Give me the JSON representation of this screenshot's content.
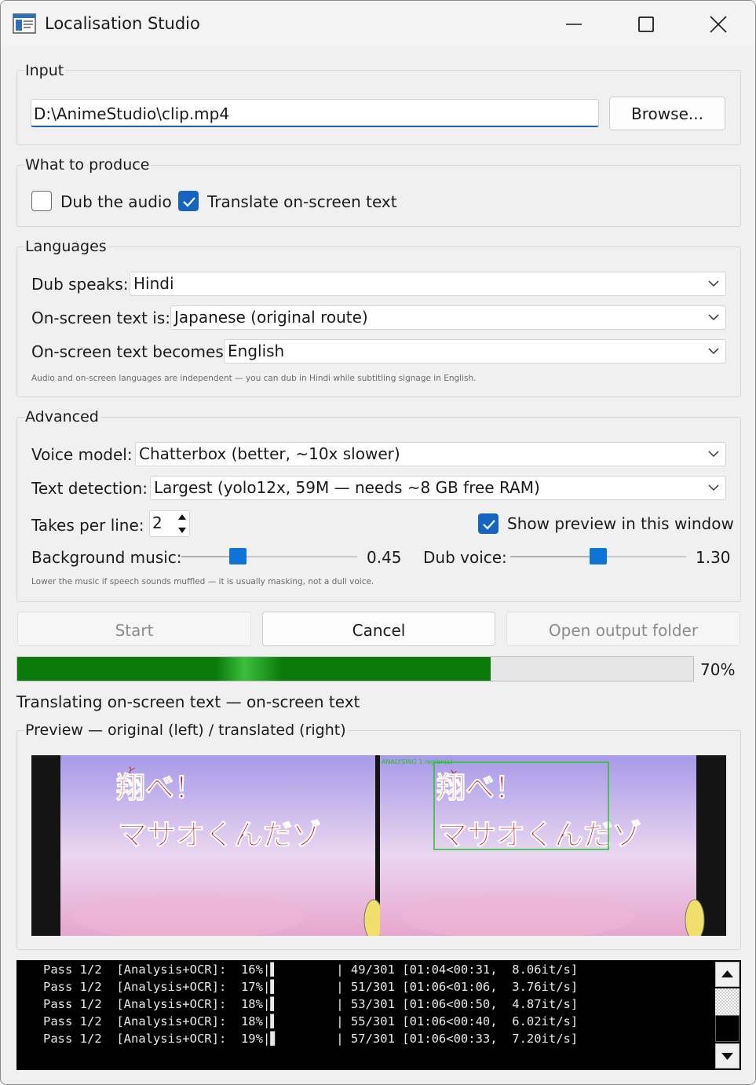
{
  "window": {
    "title": "Localisation Studio"
  },
  "input": {
    "group_title": "Input",
    "path_value": "D:\\AnimeStudio\\clip.mp4",
    "browse_label": "Browse..."
  },
  "produce": {
    "group_title": "What to produce",
    "dub_label": "Dub the audio",
    "dub_checked": false,
    "translate_label": "Translate on-screen text",
    "translate_checked": true
  },
  "languages": {
    "group_title": "Languages",
    "dub_speaks_label": "Dub speaks:",
    "dub_speaks_value": "Hindi",
    "onscreen_is_label": "On-screen text is:",
    "onscreen_is_value": "Japanese (original route)",
    "onscreen_becomes_label": "On-screen text becomes:",
    "onscreen_becomes_value": "English",
    "hint": "Audio and on-screen languages are independent — you can dub in Hindi while subtitling signage in English."
  },
  "advanced": {
    "group_title": "Advanced",
    "voice_model_label": "Voice model:",
    "voice_model_value": "Chatterbox (better, ~10x slower)",
    "text_detection_label": "Text detection:",
    "text_detection_value": "Largest (yolo12x, 59M — needs ~8 GB free RAM)",
    "takes_label": "Takes per line:",
    "takes_value": "2",
    "show_preview_label": "Show preview in this window",
    "show_preview_checked": true,
    "bg_music_label": "Background music:",
    "bg_music_value": "0.45",
    "bg_music_level": 0.45,
    "dub_voice_label": "Dub voice:",
    "dub_voice_value": "1.30",
    "dub_voice_level": 1.3,
    "hint": "Lower the music if speech sounds muffled — it is usually masking, not a dull voice."
  },
  "actions": {
    "start_label": "Start",
    "cancel_label": "Cancel",
    "open_folder_label": "Open output folder"
  },
  "progress": {
    "percent": 70,
    "percent_label": "70%",
    "status": "Translating on-screen text — on-screen text"
  },
  "preview": {
    "group_title": "Preview — original (left) / translated (right)",
    "left_furigana": "と",
    "left_line1": "翔べ！",
    "left_line2": "マサオくんだゾ",
    "right_furigana": "と",
    "right_line1": "翔べ！",
    "right_line2": "マサオくんだゾ",
    "overlay_label": "ANALYSING  1 region(s)"
  },
  "console": {
    "lines": [
      "Pass 1/2  [Analysis+OCR]:  16%|▌        | 49/301 [01:04<00:31,  8.06it/s]",
      "Pass 1/2  [Analysis+OCR]:  17%|▌        | 51/301 [01:06<01:06,  3.76it/s]",
      "Pass 1/2  [Analysis+OCR]:  18%|▌        | 53/301 [01:06<00:50,  4.87it/s]",
      "Pass 1/2  [Analysis+OCR]:  18%|▌        | 55/301 [01:06<00:40,  6.02it/s]",
      "Pass 1/2  [Analysis+OCR]:  19%|▋        | 57/301 [01:06<00:33,  7.20it/s]"
    ]
  },
  "colors": {
    "accent": "#1565c0",
    "progress_green": "#0a7a0a",
    "slider_blue": "#0f74d8",
    "detection_green": "#22c422"
  }
}
